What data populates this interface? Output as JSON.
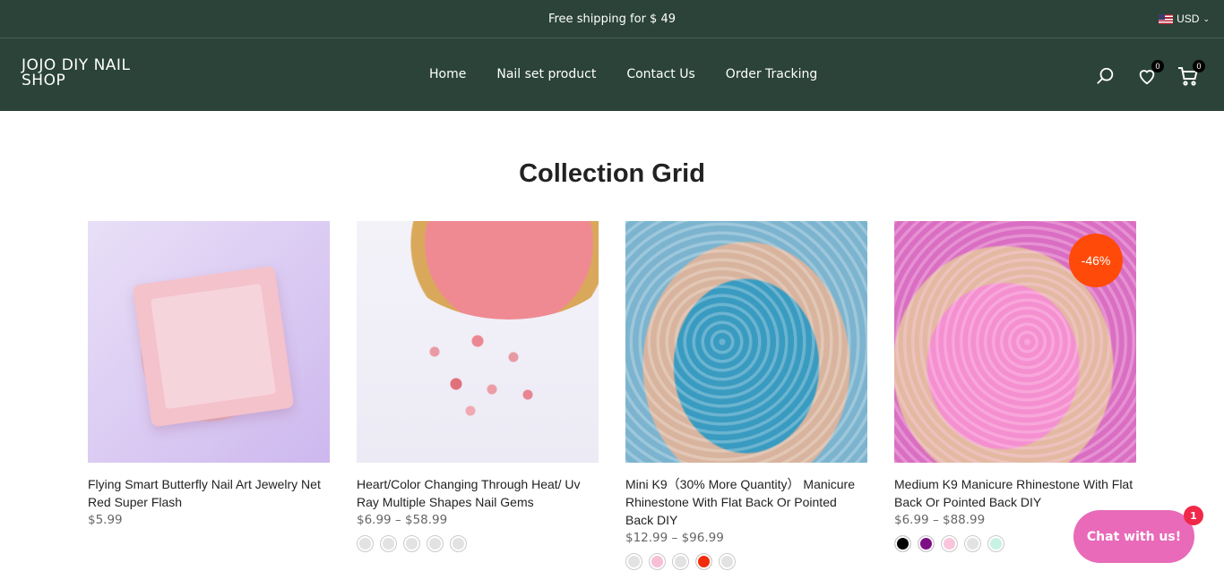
{
  "announcement": {
    "text": "Free shipping for  $ 49"
  },
  "currency": {
    "label": "USD"
  },
  "header": {
    "logo": "JOJO DIY NAIL SHOP",
    "nav": [
      "Home",
      "Nail set product",
      "Contact Us",
      "Order Tracking"
    ],
    "wishlist_count": "0",
    "cart_count": "0"
  },
  "title": "Collection Grid",
  "products": [
    {
      "name": "Flying Smart Butterfly Nail Art Jewelry Net Red Super Flash",
      "price": "$5.99",
      "swatches": []
    },
    {
      "name": "Heart/Color Changing Through Heat/ Uv Ray Multiple Shapes Nail Gems",
      "price": "$6.99 – $58.99",
      "swatches": [
        "#e2e2e2",
        "#e2e2e2",
        "#e2e2e2",
        "#e2e2e2",
        "#e2e2e2"
      ]
    },
    {
      "name": "Mini K9（30% More Quantity） Manicure Rhinestone With Flat Back Or Pointed Back DIY",
      "price": "$12.99 – $96.99",
      "swatches": [
        "#e2e2e2",
        "#f7bfd6",
        "#e2e2e2",
        "#f02c0a",
        "#e2e2e2"
      ]
    },
    {
      "name": "Medium K9 Manicure Rhinestone With Flat Back Or Pointed Back DIY",
      "price": "$6.99 – $88.99",
      "sale": "-46%",
      "swatches": [
        "#000000",
        "#7d0f85",
        "#f8c5dc",
        "#e2e2e2",
        "#c8f2e3"
      ]
    }
  ],
  "chat": {
    "label": "Chat with us!",
    "badge": "1"
  },
  "colors": {
    "header_bg": "#2b4339",
    "sale": "#ff4a0a",
    "chat": "#e86ab8"
  }
}
